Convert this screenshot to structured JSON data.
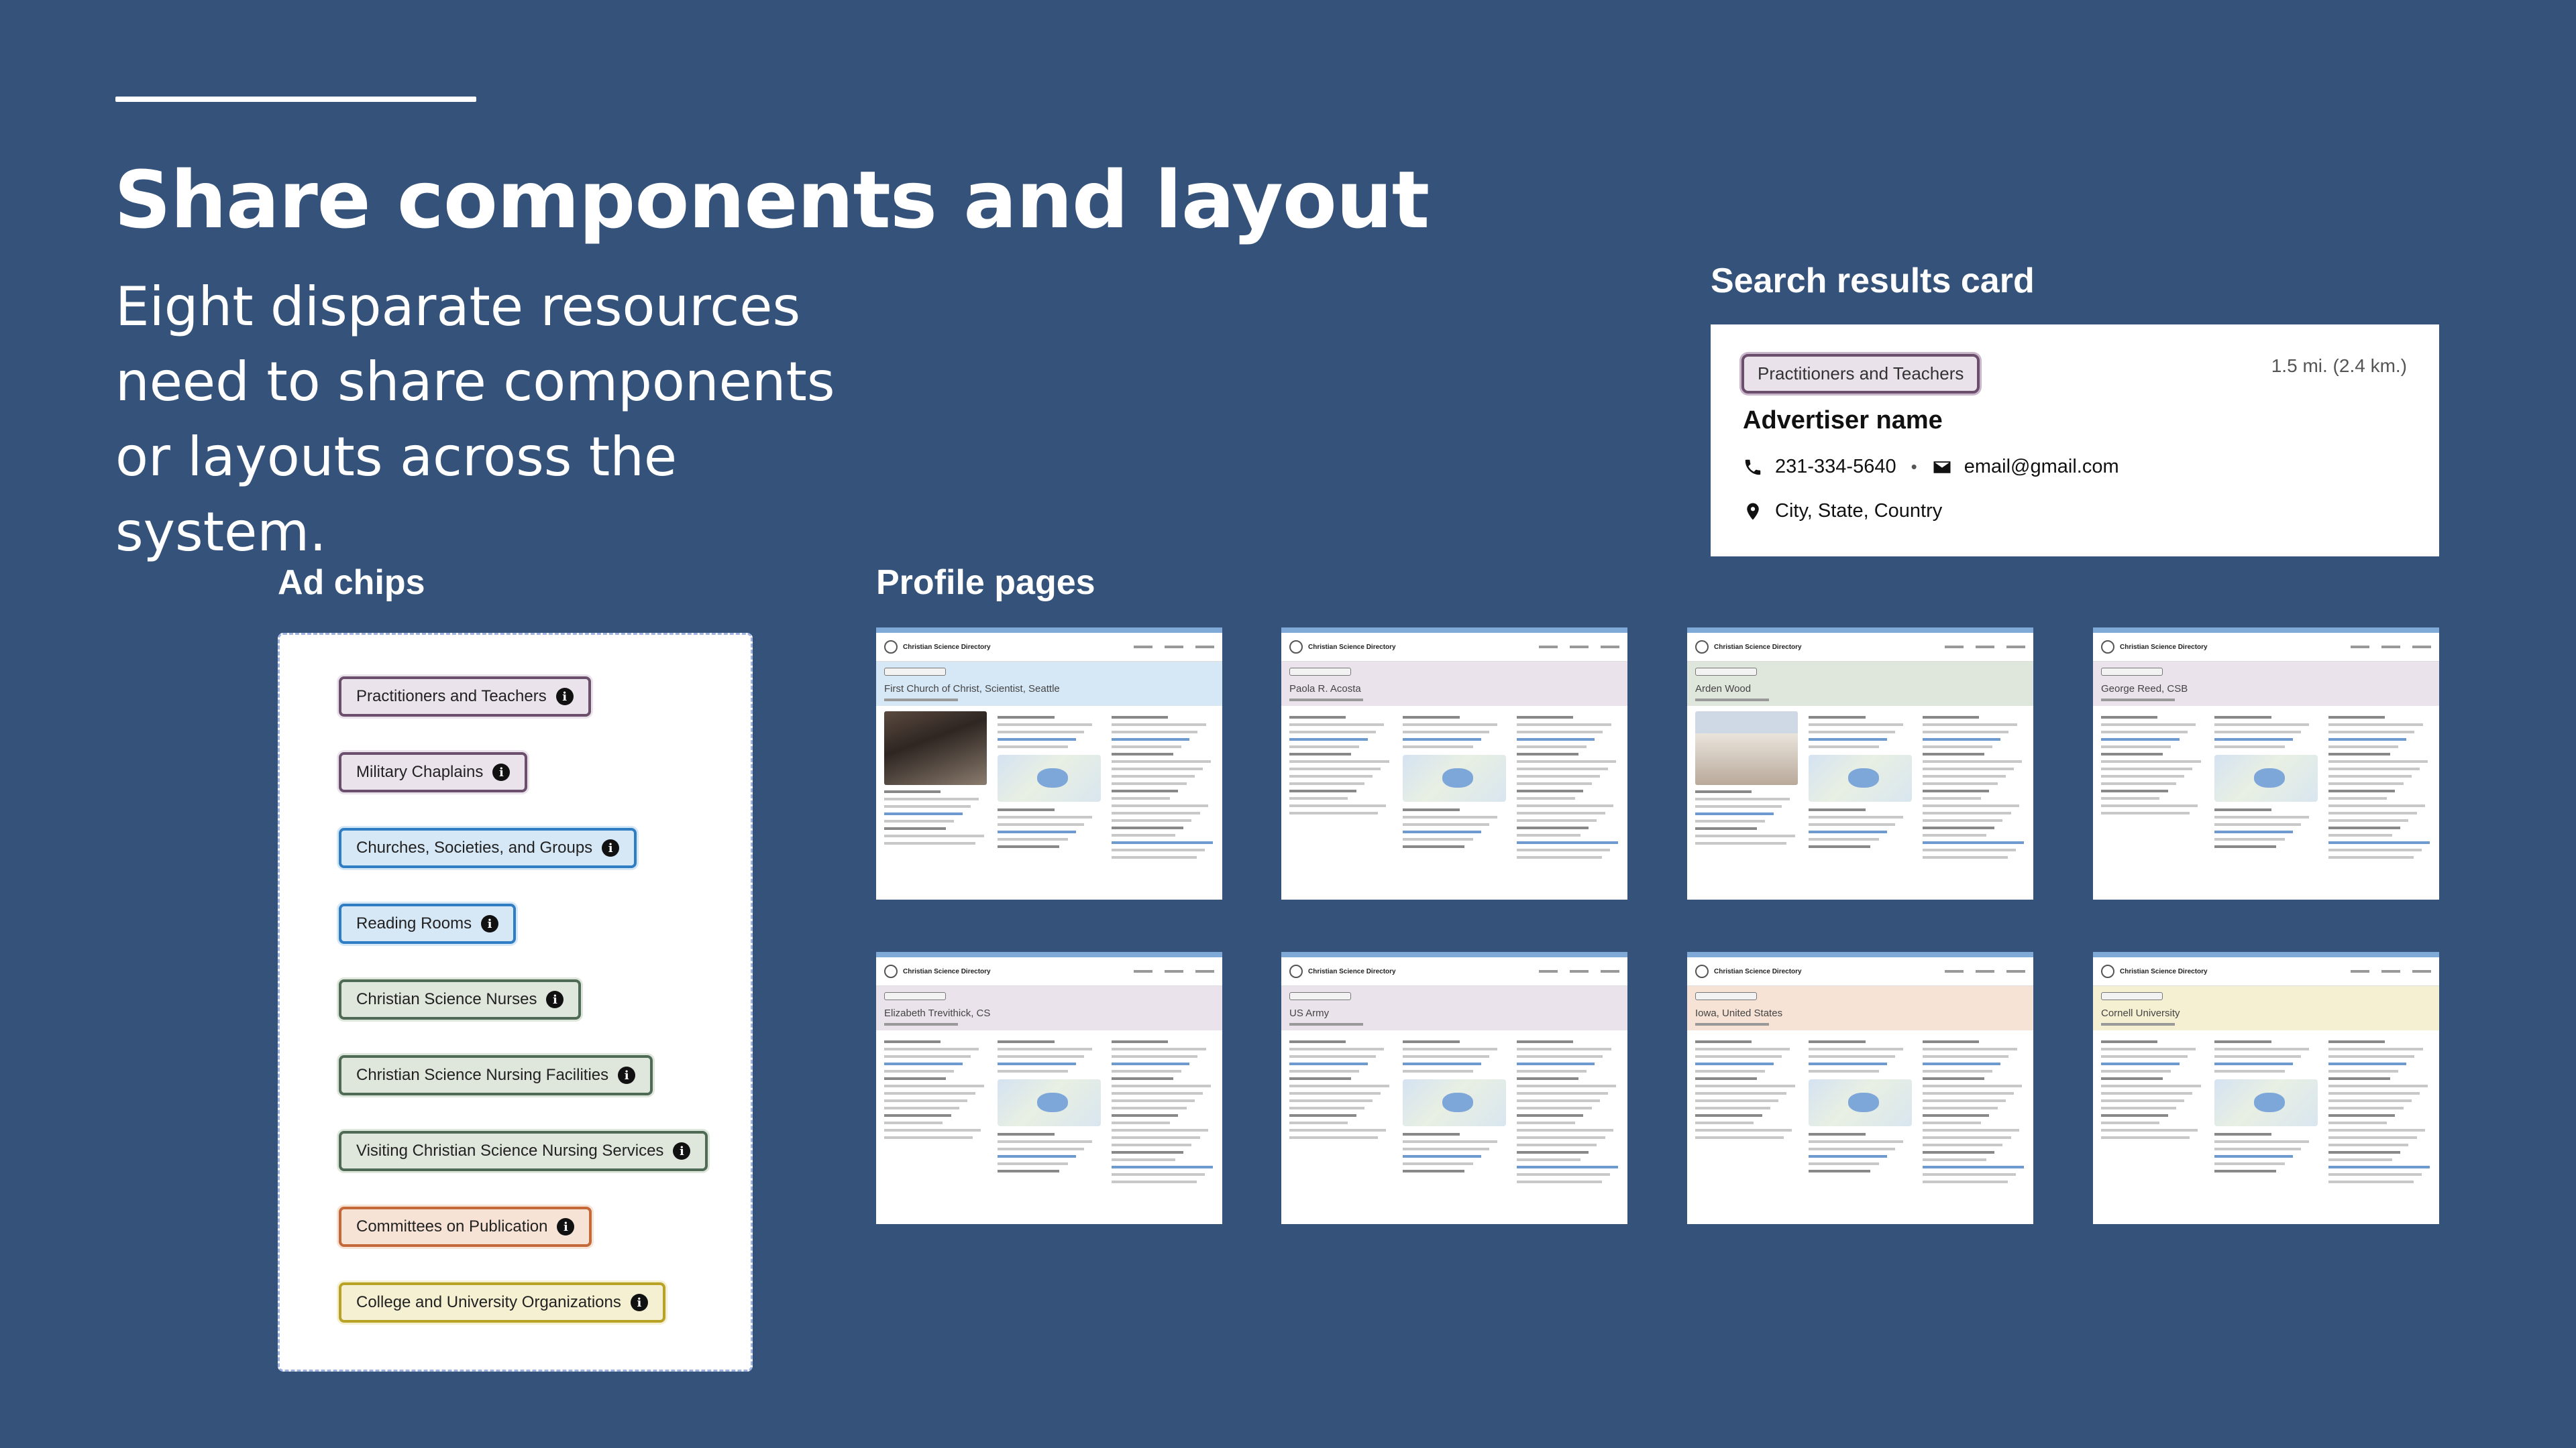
{
  "header": {
    "title": "Share components and layout",
    "subtitle": "Eight disparate resources need to share components or layouts across the system."
  },
  "sections": {
    "search_card": "Search results card",
    "ad_chips": "Ad chips",
    "profile_pages": "Profile pages"
  },
  "search_card": {
    "chip": "Practitioners and Teachers",
    "distance": "1.5 mi. (2.4 km.)",
    "name": "Advertiser name",
    "phone": "231-334-5640",
    "email": "email@gmail.com",
    "location": "City, State, Country"
  },
  "ad_chips": [
    {
      "label": "Practitioners and Teachers",
      "bg": "#ebe3ec",
      "border": "#6b4f6d"
    },
    {
      "label": "Military Chaplains",
      "bg": "#ebe3ec",
      "border": "#6b4f6d"
    },
    {
      "label": "Churches, Societies, and Groups",
      "bg": "#d6e7f6",
      "border": "#2f7ec4"
    },
    {
      "label": "Reading Rooms",
      "bg": "#d6e7f6",
      "border": "#2f7ec4"
    },
    {
      "label": "Christian Science Nurses",
      "bg": "#dfe7dc",
      "border": "#4f6b55"
    },
    {
      "label": "Christian Science Nursing Facilities",
      "bg": "#dfe7dc",
      "border": "#4f6b55"
    },
    {
      "label": "Visiting Christian Science Nursing Services",
      "bg": "#dfe7dc",
      "border": "#4f6b55"
    },
    {
      "label": "Committees on Publication",
      "bg": "#f7e3d6",
      "border": "#c4693a"
    },
    {
      "label": "College and University Organizations",
      "bg": "#f5f0d2",
      "border": "#b9a326"
    }
  ],
  "profiles": [
    {
      "name": "First Church of Christ, Scientist, Seattle",
      "hero": "#d6e7f6",
      "photo": "church"
    },
    {
      "name": "Paola R. Acosta",
      "hero": "#ebe3ec",
      "photo": ""
    },
    {
      "name": "Arden Wood",
      "hero": "#dfe7dc",
      "photo": "house"
    },
    {
      "name": "George Reed, CSB",
      "hero": "#ebe3ec",
      "photo": ""
    },
    {
      "name": "Elizabeth Trevithick, CS",
      "hero": "#ebe3ec",
      "photo": ""
    },
    {
      "name": "US Army",
      "hero": "#ebe3ec",
      "photo": ""
    },
    {
      "name": "Iowa, United States",
      "hero": "#f7e3d6",
      "photo": ""
    },
    {
      "name": "Cornell University",
      "hero": "#f5f0d2",
      "photo": ""
    }
  ],
  "thumb_brand": "Christian Science Directory"
}
